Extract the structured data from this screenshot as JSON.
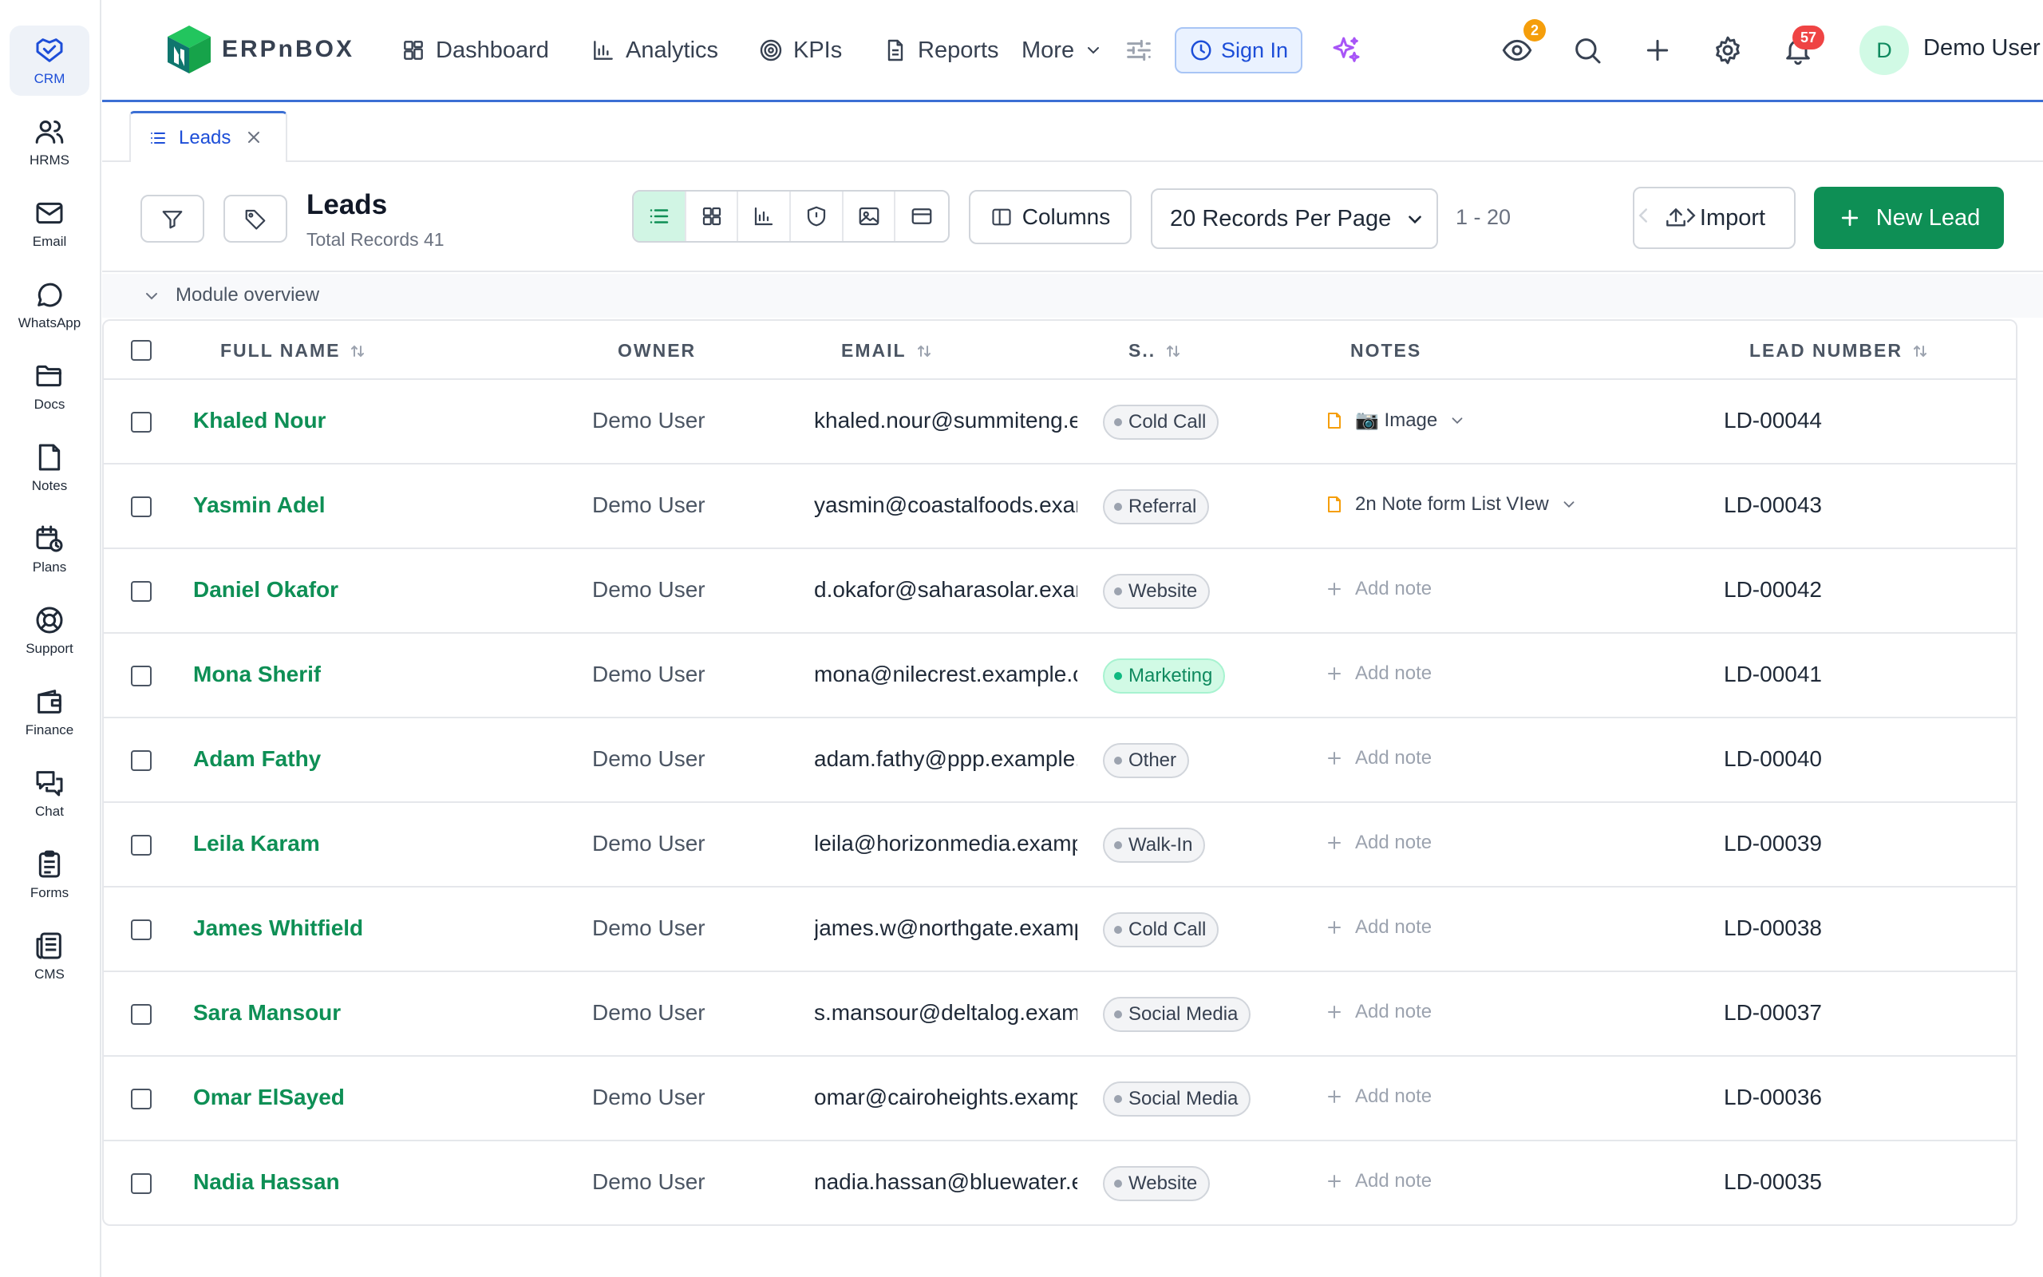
{
  "sidebar": {
    "items": [
      {
        "label": "CRM",
        "icon": "crm-handshake-icon",
        "active": true
      },
      {
        "label": "HRMS",
        "icon": "people-icon"
      },
      {
        "label": "Email",
        "icon": "mail-icon"
      },
      {
        "label": "WhatsApp",
        "icon": "chat-bubble-icon"
      },
      {
        "label": "Docs",
        "icon": "folder-icon"
      },
      {
        "label": "Notes",
        "icon": "note-icon"
      },
      {
        "label": "Plans",
        "icon": "calendar-clock-icon"
      },
      {
        "label": "Support",
        "icon": "lifebuoy-icon"
      },
      {
        "label": "Finance",
        "icon": "wallet-icon"
      },
      {
        "label": "Chat",
        "icon": "chat-icon"
      },
      {
        "label": "Forms",
        "icon": "clipboard-icon"
      },
      {
        "label": "CMS",
        "icon": "newspaper-icon"
      }
    ]
  },
  "topbar": {
    "brand": "ERPnBOX",
    "nav": {
      "dashboard": "Dashboard",
      "analytics": "Analytics",
      "kpis": "KPIs",
      "reports": "Reports",
      "more": "More"
    },
    "sign_in": "Sign In",
    "watch_count": "2",
    "notification_count": "57",
    "user_initial": "D",
    "user_name": "Demo User"
  },
  "tabs": [
    {
      "label": "Leads"
    }
  ],
  "toolbar": {
    "title": "Leads",
    "subtitle": "Total Records 41",
    "columns_label": "Columns",
    "records_per_page": "20 Records Per Page",
    "range": "1 - 20",
    "import_label": "Import",
    "new_lead_label": "New Lead"
  },
  "overview": {
    "label": "Module overview"
  },
  "table": {
    "headers": {
      "full_name": "FULL NAME",
      "owner": "OWNER",
      "email": "EMAIL",
      "source": "S..",
      "notes": "NOTES",
      "lead_number": "LEAD NUMBER"
    },
    "rows": [
      {
        "name": "Khaled Nour",
        "owner": "Demo User",
        "email": "khaled.nour@summiteng.e",
        "source": "Cold Call",
        "note": "📷 Image",
        "note_type": "note",
        "lead_no": "LD-00044"
      },
      {
        "name": "Yasmin Adel",
        "owner": "Demo User",
        "email": "yasmin@coastalfoods.exar",
        "source": "Referral",
        "note": "2n Note form List VIew",
        "note_type": "note",
        "lead_no": "LD-00043"
      },
      {
        "name": "Daniel Okafor",
        "owner": "Demo User",
        "email": "d.okafor@saharasolar.exan",
        "source": "Website",
        "note": "Add note",
        "note_type": "add",
        "lead_no": "LD-00042"
      },
      {
        "name": "Mona Sherif",
        "owner": "Demo User",
        "email": "mona@nilecrest.example.c",
        "source": "Marketing",
        "note": "Add note",
        "note_type": "add",
        "lead_no": "LD-00041"
      },
      {
        "name": "Adam Fathy",
        "owner": "Demo User",
        "email": "adam.fathy@ppp.example.",
        "source": "Other",
        "note": "Add note",
        "note_type": "add",
        "lead_no": "LD-00040"
      },
      {
        "name": "Leila Karam",
        "owner": "Demo User",
        "email": "leila@horizonmedia.examp",
        "source": "Walk-In",
        "note": "Add note",
        "note_type": "add",
        "lead_no": "LD-00039"
      },
      {
        "name": "James Whitfield",
        "owner": "Demo User",
        "email": "james.w@northgate.examp",
        "source": "Cold Call",
        "note": "Add note",
        "note_type": "add",
        "lead_no": "LD-00038"
      },
      {
        "name": "Sara Mansour",
        "owner": "Demo User",
        "email": "s.mansour@deltalog.exam",
        "source": "Social Media",
        "note": "Add note",
        "note_type": "add",
        "lead_no": "LD-00037"
      },
      {
        "name": "Omar ElSayed",
        "owner": "Demo User",
        "email": "omar@cairoheights.examp",
        "source": "Social Media",
        "note": "Add note",
        "note_type": "add",
        "lead_no": "LD-00036"
      },
      {
        "name": "Nadia Hassan",
        "owner": "Demo User",
        "email": "nadia.hassan@bluewater.e",
        "source": "Website",
        "note": "Add note",
        "note_type": "add",
        "lead_no": "LD-00035"
      }
    ]
  },
  "colors": {
    "accent_blue": "#3b6fd4",
    "brand_green": "#0e8f55",
    "watch_badge": "#f59e0b",
    "notification_badge": "#ef4444",
    "marketing_pill": "#d1fae5"
  }
}
